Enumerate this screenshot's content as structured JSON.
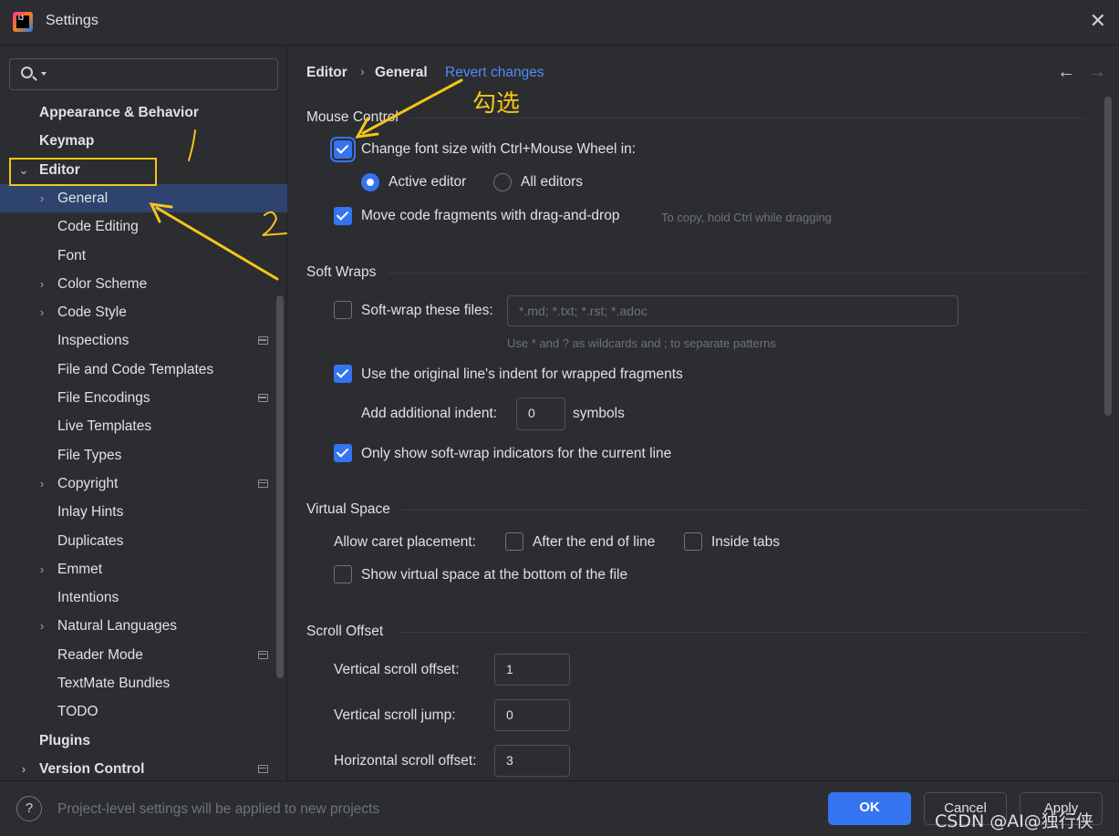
{
  "window": {
    "title": "Settings",
    "app_icon": "intellij-idea-icon",
    "app_icon_text": "IJ"
  },
  "search": {
    "placeholder": ""
  },
  "sidebar": {
    "items": [
      {
        "label": "Appearance & Behavior",
        "level": 0,
        "bold": true,
        "expandable": false
      },
      {
        "label": "Keymap",
        "level": 0,
        "bold": true,
        "expandable": false
      },
      {
        "label": "Editor",
        "level": 0,
        "bold": true,
        "expandable": true,
        "expanded": true
      },
      {
        "label": "General",
        "level": 1,
        "expandable": true,
        "selected": true
      },
      {
        "label": "Code Editing",
        "level": 1
      },
      {
        "label": "Font",
        "level": 1
      },
      {
        "label": "Color Scheme",
        "level": 1,
        "expandable": true
      },
      {
        "label": "Code Style",
        "level": 1,
        "expandable": true
      },
      {
        "label": "Inspections",
        "level": 1,
        "project_icon": true
      },
      {
        "label": "File and Code Templates",
        "level": 1
      },
      {
        "label": "File Encodings",
        "level": 1,
        "project_icon": true
      },
      {
        "label": "Live Templates",
        "level": 1
      },
      {
        "label": "File Types",
        "level": 1
      },
      {
        "label": "Copyright",
        "level": 1,
        "expandable": true,
        "project_icon": true
      },
      {
        "label": "Inlay Hints",
        "level": 1
      },
      {
        "label": "Duplicates",
        "level": 1
      },
      {
        "label": "Emmet",
        "level": 1,
        "expandable": true
      },
      {
        "label": "Intentions",
        "level": 1
      },
      {
        "label": "Natural Languages",
        "level": 1,
        "expandable": true
      },
      {
        "label": "Reader Mode",
        "level": 1,
        "project_icon": true
      },
      {
        "label": "TextMate Bundles",
        "level": 1
      },
      {
        "label": "TODO",
        "level": 1
      },
      {
        "label": "Plugins",
        "level": 0,
        "bold": true
      },
      {
        "label": "Version Control",
        "level": 0,
        "bold": true,
        "expandable": true,
        "project_icon": true
      }
    ]
  },
  "breadcrumb": {
    "parent": "Editor",
    "separator": "›",
    "current": "General",
    "revert": "Revert changes"
  },
  "mouse_control": {
    "title": "Mouse Control",
    "font_zoom": {
      "label": "Change font size with Ctrl+Mouse Wheel in:",
      "checked": true
    },
    "active_editor": {
      "label": "Active editor",
      "selected": true
    },
    "all_editors": {
      "label": "All editors",
      "selected": false
    },
    "drag_drop": {
      "label": "Move code fragments with drag-and-drop",
      "checked": true,
      "hint": "To copy, hold Ctrl while dragging"
    }
  },
  "soft_wraps": {
    "title": "Soft Wraps",
    "wrap_files": {
      "label": "Soft-wrap these files:",
      "checked": false,
      "placeholder": "*.md; *.txt; *.rst; *.adoc",
      "hint": "Use * and ? as wildcards and ; to separate patterns"
    },
    "original_indent": {
      "label": "Use the original line's indent for wrapped fragments",
      "checked": true
    },
    "additional_indent": {
      "label": "Add additional indent:",
      "value": "0",
      "unit": "symbols"
    },
    "indicators": {
      "label": "Only show soft-wrap indicators for the current line",
      "checked": true
    }
  },
  "virtual_space": {
    "title": "Virtual Space",
    "caret_label": "Allow caret placement:",
    "after_end": {
      "label": "After the end of line",
      "checked": false
    },
    "inside_tabs": {
      "label": "Inside tabs",
      "checked": false
    },
    "bottom": {
      "label": "Show virtual space at the bottom of the file",
      "checked": false
    }
  },
  "scroll_offset": {
    "title": "Scroll Offset",
    "vertical_offset": {
      "label": "Vertical scroll offset:",
      "value": "1"
    },
    "vertical_jump": {
      "label": "Vertical scroll jump:",
      "value": "0"
    },
    "horizontal_offset": {
      "label": "Horizontal scroll offset:",
      "value": "3"
    }
  },
  "footer": {
    "help": "?",
    "message": "Project-level settings will be applied to new projects",
    "ok": "OK",
    "cancel": "Cancel",
    "apply": "Apply"
  },
  "annotations": {
    "check_note": "勾选",
    "step1": "1",
    "step2": "2",
    "color": "#f5c518"
  },
  "watermark": "CSDN @AI@独行侠",
  "colors": {
    "accent": "#3574f0",
    "link": "#548af7",
    "background": "#2b2d30",
    "selection": "#2e436e"
  }
}
